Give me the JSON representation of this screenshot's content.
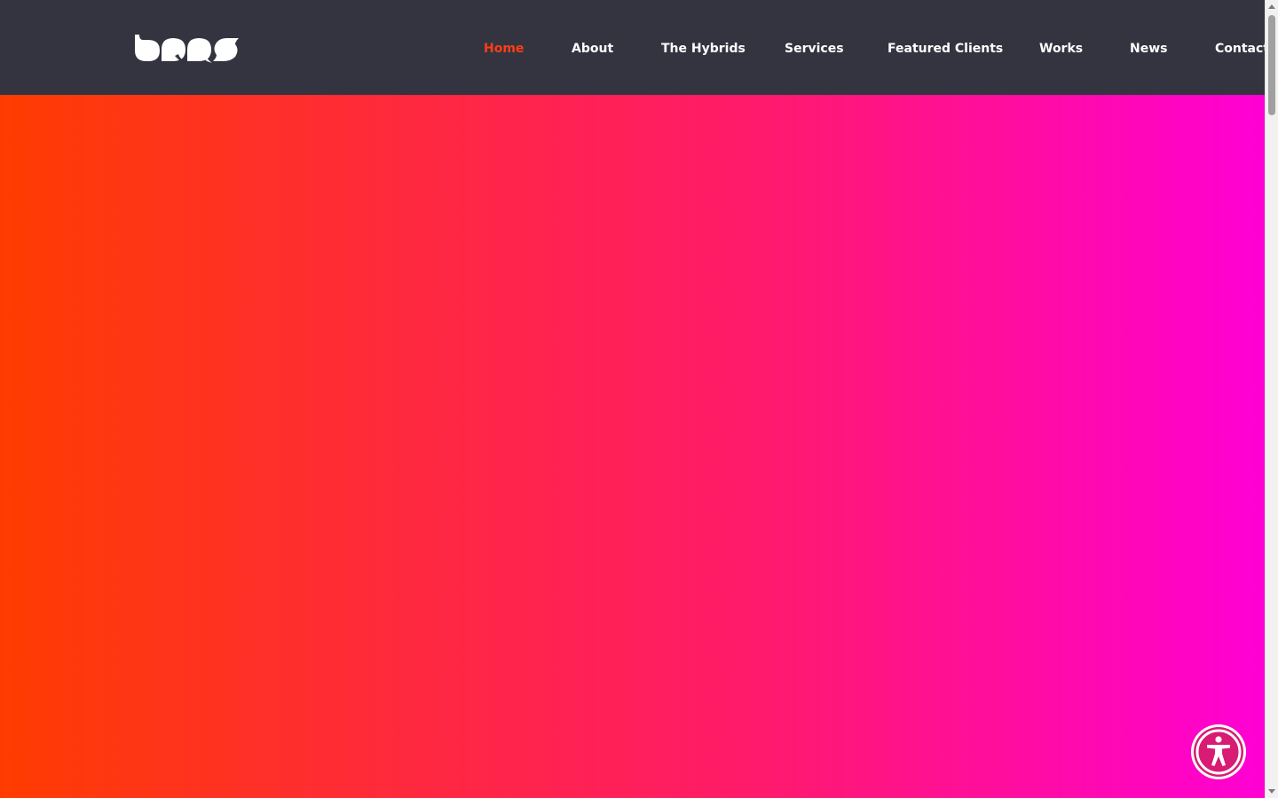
{
  "brand": {
    "logo_icon": "brand-wordmark-logo"
  },
  "nav": {
    "items": [
      {
        "label": "Home",
        "active": true
      },
      {
        "label": "About",
        "active": false
      },
      {
        "label": "The Hybrids",
        "active": false
      },
      {
        "label": "Services",
        "active": false
      },
      {
        "label": "Featured Clients",
        "active": false
      },
      {
        "label": "Works",
        "active": false
      },
      {
        "label": "News",
        "active": false
      },
      {
        "label": "Contact",
        "active": false
      }
    ]
  },
  "hero": {
    "gradient": [
      "#ff3c00",
      "#ff2a3a",
      "#ff1a6c",
      "#ff00d4"
    ]
  },
  "accessibility": {
    "icon": "accessibility-icon"
  },
  "colors": {
    "header_bg": "#333440",
    "nav_text": "#ffffff",
    "nav_active": "#ff3d14",
    "a11y_ring": "#d81b73"
  }
}
